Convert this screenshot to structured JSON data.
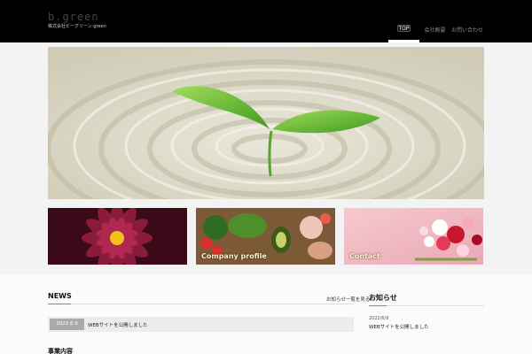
{
  "header": {
    "logo_text": "b.green",
    "tagline": "株式会社ビーグリーン·green"
  },
  "nav": {
    "items": [
      {
        "label": "TOP",
        "active": true
      },
      {
        "label": "会社概要",
        "active": false
      },
      {
        "label": "お問い合わせ",
        "active": false
      }
    ]
  },
  "banners": {
    "flower_dahlia": {
      "label": ""
    },
    "company_profile": {
      "label": "Company profile"
    },
    "contact": {
      "label": "Contact"
    }
  },
  "news": {
    "title": "NEWS",
    "more_label": "お知らせ一覧を見る",
    "items": [
      {
        "date": "2022.6.9",
        "text": "WEBサイトを公開しました"
      }
    ]
  },
  "sidebar": {
    "title": "お知らせ",
    "items": [
      {
        "date": "2022/6/9",
        "text": "WEBサイトを公開しました"
      }
    ]
  },
  "bottom": {
    "title": "事業内容"
  },
  "colors": {
    "header_bg": "#000000",
    "accent_white": "#ffffff",
    "date_badge": "#aaaaaa"
  }
}
